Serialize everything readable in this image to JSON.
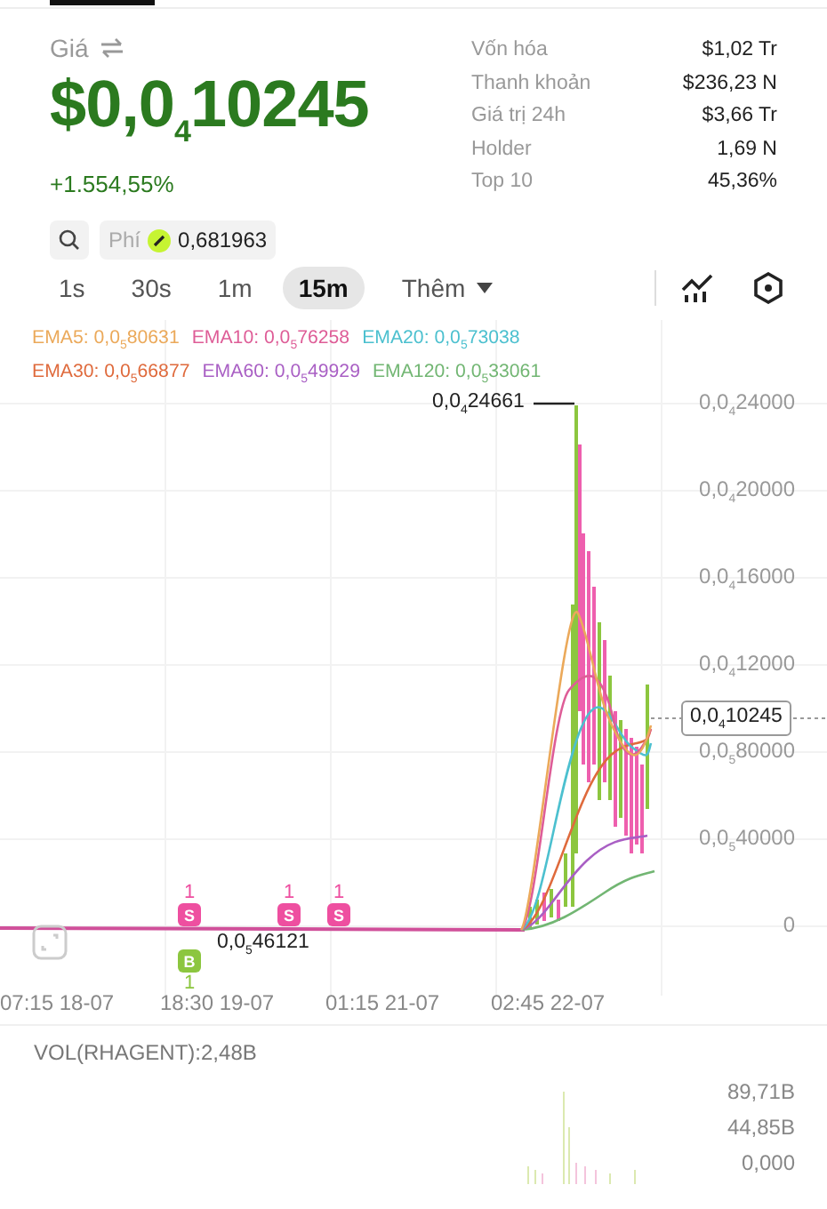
{
  "price": {
    "label": "Giá",
    "value": "$0,0$_{4}$10245",
    "change": "+1.554,55%"
  },
  "stats": [
    {
      "label": "Vốn hóa",
      "value": "$1,02 Tr"
    },
    {
      "label": "Thanh khoản",
      "value": "$236,23 N"
    },
    {
      "label": "Giá trị 24h",
      "value": "$3,66 Tr"
    },
    {
      "label": "Holder",
      "value": "1,69 N"
    },
    {
      "label": "Top 10",
      "value": "45,36%"
    }
  ],
  "fee": {
    "label": "Phí",
    "value": "0,681963"
  },
  "timeframes": [
    {
      "label": "1s",
      "selected": false
    },
    {
      "label": "30s",
      "selected": false
    },
    {
      "label": "1m",
      "selected": false
    },
    {
      "label": "15m",
      "selected": true
    }
  ],
  "more": "Thêm",
  "ema_legend": [
    {
      "text": "EMA5: 0,0$_{5}$80631",
      "color": "#eba95a"
    },
    {
      "text": "EMA10: 0,0$_{5}$76258",
      "color": "#de5d97"
    },
    {
      "text": "EMA20: 0,0$_{5}$73038",
      "color": "#4cc0cf"
    },
    {
      "text": "EMA30: 0,0$_{5}$66877",
      "color": "#df6a3c"
    },
    {
      "text": "EMA60: 0,0$_{5}$49929",
      "color": "#a95fc4"
    },
    {
      "text": "EMA120: 0,0$_{5}$33061",
      "color": "#72b673"
    }
  ],
  "y_axis": [
    "0,0$_{4}$24000",
    "0,0$_{4}$20000",
    "0,0$_{4}$16000",
    "0,0$_{4}$12000",
    "0,0$_{5}$80000",
    "0,0$_{5}$40000",
    "0"
  ],
  "high_label": "0,0$_{4}$24661",
  "low_label": "0,0$_{5}$46121",
  "current_price": "0,0$_{4}$10245",
  "markers": [
    {
      "kind": "sell",
      "letter": "S",
      "count": "1"
    },
    {
      "kind": "buy",
      "letter": "B",
      "count": "1"
    },
    {
      "kind": "sell",
      "letter": "S",
      "count": "1"
    },
    {
      "kind": "sell",
      "letter": "S",
      "count": "1"
    }
  ],
  "x_axis": [
    "07:15 18-07",
    "18:30 19-07",
    "01:15 21-07",
    "02:45 22-07"
  ],
  "volume": {
    "label": "VOL(RHAGENT):2,48B",
    "ticks": [
      "89,71B",
      "44,85B",
      "0,000"
    ]
  }
}
